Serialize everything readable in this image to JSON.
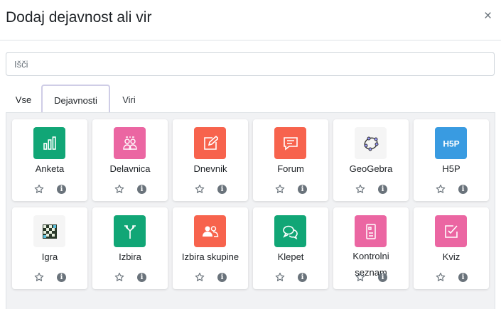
{
  "modal": {
    "title": "Dodaj dejavnost ali vir",
    "close_symbol": "×"
  },
  "search": {
    "placeholder": "Išči"
  },
  "tabs": [
    {
      "label": "Vse",
      "active": false
    },
    {
      "label": "Dejavnosti",
      "active": true
    },
    {
      "label": "Viri",
      "active": false
    }
  ],
  "activities": [
    {
      "name": "Anketa",
      "icon": "bar-chart-icon",
      "color": "#11a676"
    },
    {
      "name": "Delavnica",
      "icon": "people-icon",
      "color": "#eb66a2"
    },
    {
      "name": "Dnevnik",
      "icon": "edit-icon",
      "color": "#f7634d"
    },
    {
      "name": "Forum",
      "icon": "message-icon",
      "color": "#f7634d"
    },
    {
      "name": "GeoGebra",
      "icon": "geogebra-icon",
      "color": "#f5f5f5"
    },
    {
      "name": "H5P",
      "icon": "h5p-icon",
      "color": "#399be1"
    },
    {
      "name": "Igra",
      "icon": "game-board-icon",
      "color": "#f5f5f5"
    },
    {
      "name": "Izbira",
      "icon": "choice-icon",
      "color": "#11a676"
    },
    {
      "name": "Izbira skupine",
      "icon": "group-icon",
      "color": "#f7634d"
    },
    {
      "name": "Klepet",
      "icon": "chat-icon",
      "color": "#11a676"
    },
    {
      "name": "Kontrolni seznam",
      "icon": "checklist-icon",
      "color": "#eb66a2"
    },
    {
      "name": "Kviz",
      "icon": "quiz-icon",
      "color": "#eb66a2"
    }
  ],
  "card_actions": {
    "star_icon": "star-icon",
    "info_icon": "info-icon",
    "info_symbol": "i"
  }
}
